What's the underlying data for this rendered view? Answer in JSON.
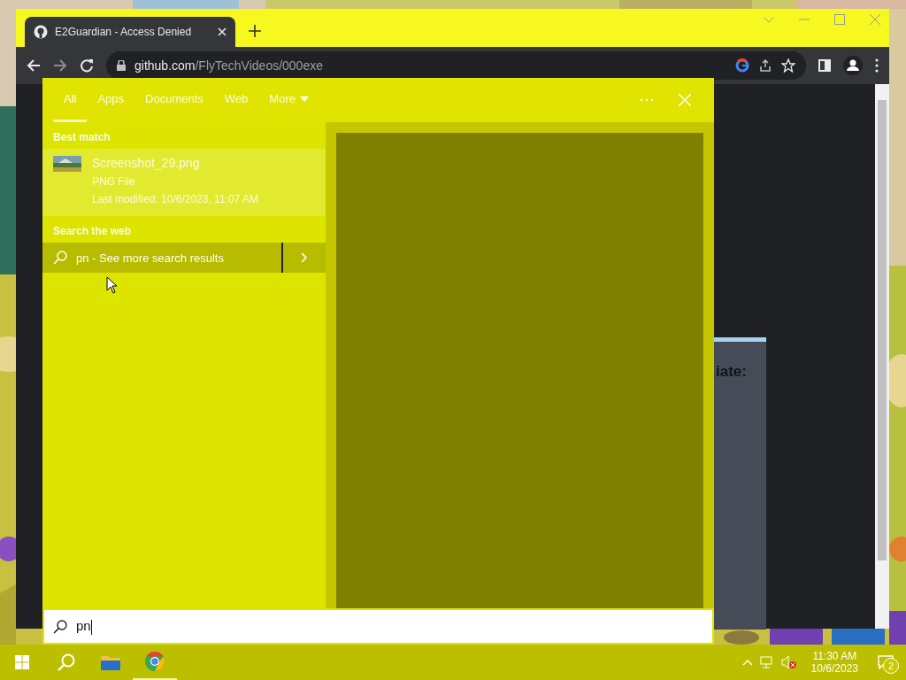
{
  "browser": {
    "tab": {
      "title": "E2Guardian - Access Denied"
    },
    "address": {
      "domain": "github.com",
      "path": "/FlyTechVideos/000exe"
    },
    "page_text": "iate:"
  },
  "search": {
    "tabs": [
      {
        "label": "All",
        "selected": true
      },
      {
        "label": "Apps",
        "selected": false
      },
      {
        "label": "Documents",
        "selected": false
      },
      {
        "label": "Web",
        "selected": false
      },
      {
        "label": "More",
        "selected": false
      }
    ],
    "best_match_heading": "Best match",
    "best_match": {
      "name": "Screenshot_29.png",
      "type": "PNG File",
      "modified": "Last modified: 10/6/2023, 11:07 AM"
    },
    "web_heading": "Search the web",
    "web_result": {
      "query": "pn",
      "hint": "- See more search results"
    },
    "query": "pn"
  },
  "taskbar": {
    "time": "11:30 AM",
    "date": "10/6/2023",
    "notifications": "2"
  }
}
